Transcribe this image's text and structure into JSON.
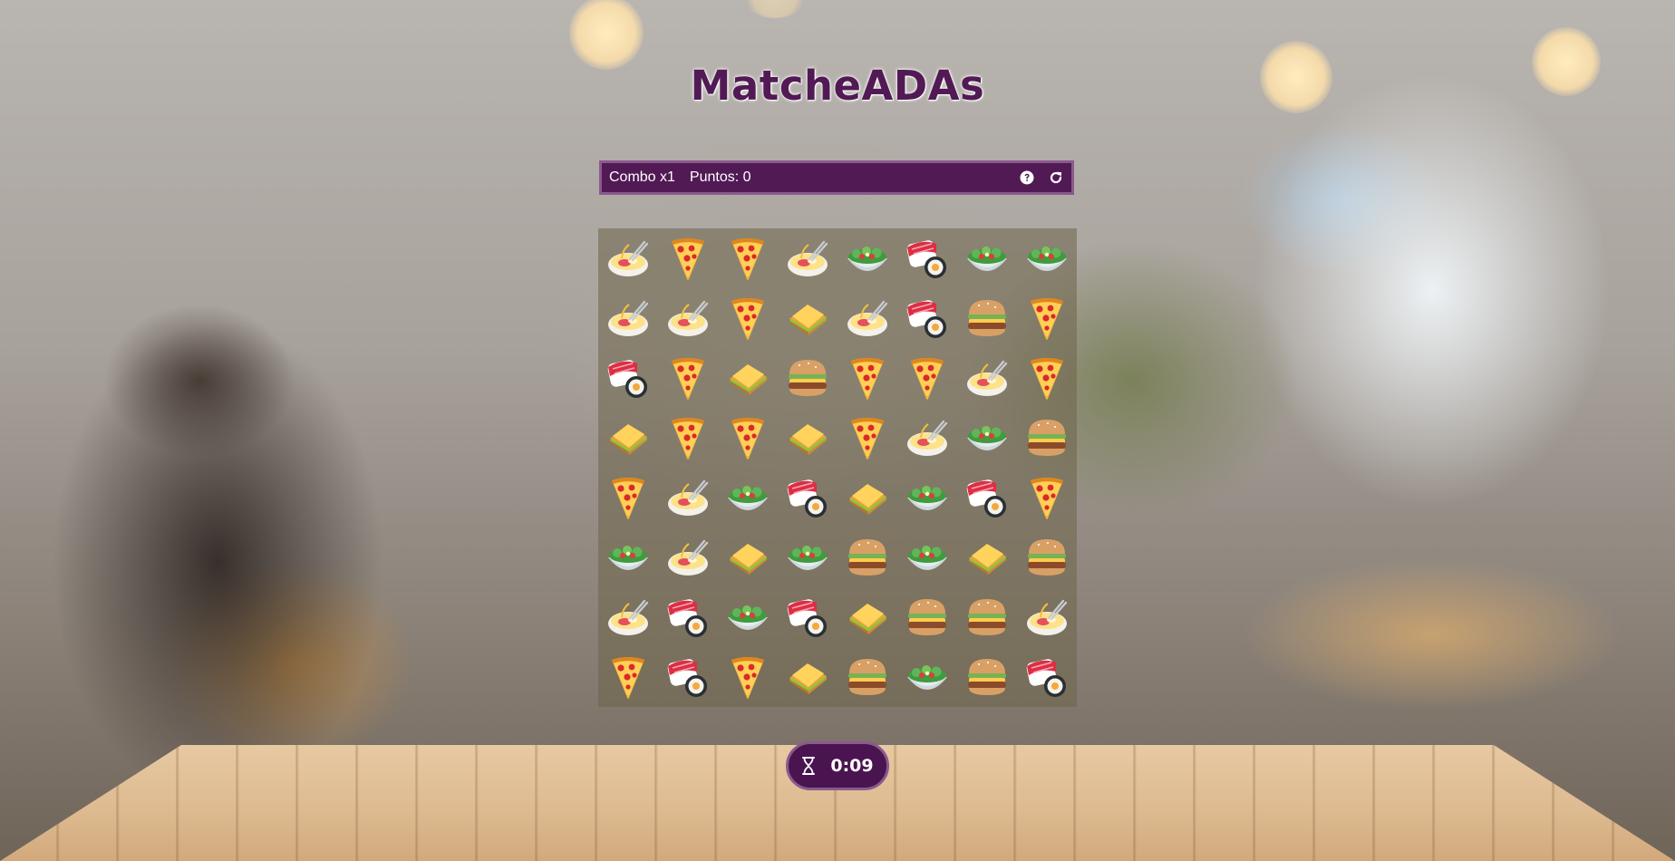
{
  "app": {
    "title": "MatcheADAs"
  },
  "status": {
    "combo": "Combo x1",
    "points": "Puntos: 0"
  },
  "toolbar": {
    "help_icon": "question-circle-icon",
    "restart_icon": "restart-icon"
  },
  "board": {
    "rows": 8,
    "cols": 8,
    "tiles": [
      [
        "ramen",
        "pizza",
        "pizza",
        "ramen",
        "salad",
        "sushi",
        "salad",
        "salad"
      ],
      [
        "ramen",
        "ramen",
        "pizza",
        "sandwich",
        "ramen",
        "sushi",
        "burger",
        "pizza"
      ],
      [
        "sushi",
        "pizza",
        "sandwich",
        "burger",
        "pizza",
        "pizza",
        "ramen",
        "pizza"
      ],
      [
        "sandwich",
        "pizza",
        "pizza",
        "sandwich",
        "pizza",
        "ramen",
        "salad",
        "burger"
      ],
      [
        "pizza",
        "ramen",
        "salad",
        "sushi",
        "sandwich",
        "salad",
        "sushi",
        "pizza"
      ],
      [
        "salad",
        "ramen",
        "sandwich",
        "salad",
        "burger",
        "salad",
        "sandwich",
        "burger"
      ],
      [
        "ramen",
        "sushi",
        "salad",
        "sushi",
        "sandwich",
        "burger",
        "burger",
        "ramen"
      ],
      [
        "pizza",
        "sushi",
        "pizza",
        "sandwich",
        "burger",
        "salad",
        "burger",
        "sushi"
      ]
    ]
  },
  "timer": {
    "icon": "hourglass-icon",
    "value": "0:09"
  },
  "colors": {
    "brand": "#521a55",
    "brand_border": "#8a5a8c",
    "board_bg": "#6e644b"
  }
}
